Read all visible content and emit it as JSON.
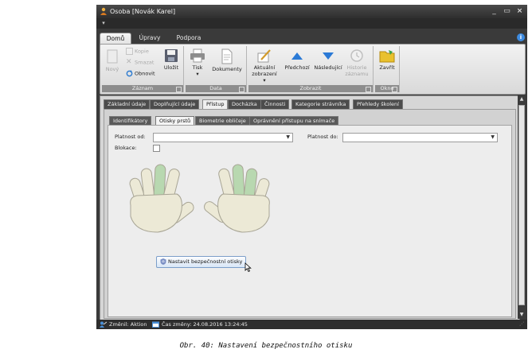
{
  "window": {
    "title": "Osoba [Novák Karel]"
  },
  "ribbon_tabs": [
    "Domů",
    "Úpravy",
    "Podpora"
  ],
  "ribbon": {
    "zaznam": {
      "label": "Záznam",
      "novy": "Nový",
      "kopie": "Kopie",
      "smazat": "Smazat",
      "obnovit": "Obnovit",
      "ulozit": "Uložit"
    },
    "data": {
      "label": "Data",
      "tisk": "Tisk",
      "dokumenty": "Dokumenty"
    },
    "zobrazit": {
      "label": "Zobrazit",
      "aktualni_1": "Aktuální",
      "aktualni_2": "zobrazení ▾",
      "predchozi": "Předchozí",
      "nasledujici": "Následující",
      "historie_1": "Historie",
      "historie_2": "záznamu"
    },
    "okno": {
      "label": "Okno",
      "zavrit": "Zavřít"
    }
  },
  "main_tabs": [
    "Základní údaje",
    "Doplňující údaje",
    "Přístup",
    "Docházka",
    "Činnosti",
    "Kategorie strávníka",
    "Přehledy školení"
  ],
  "sub_tabs": [
    "Identifikátory",
    "Otisky prstů",
    "Biometrie obličeje",
    "Oprávnění přístupu na snímače"
  ],
  "form": {
    "platnost_od": "Platnost od:",
    "platnost_do": "Platnost do:",
    "blokace": "Blokace:",
    "button": "Nastavit bezpečnostní otisky"
  },
  "status": {
    "zmenil": "Změnil: Aktion",
    "cas": "Čas změny: 24.08.2016 13:24:45"
  },
  "caption": "Obr. 40: Nastavení bezpečnostního otisku",
  "colors": {
    "highlight_finger": "#b8d8b0",
    "finger": "#ece9d6",
    "accent": "#3d8be0"
  }
}
